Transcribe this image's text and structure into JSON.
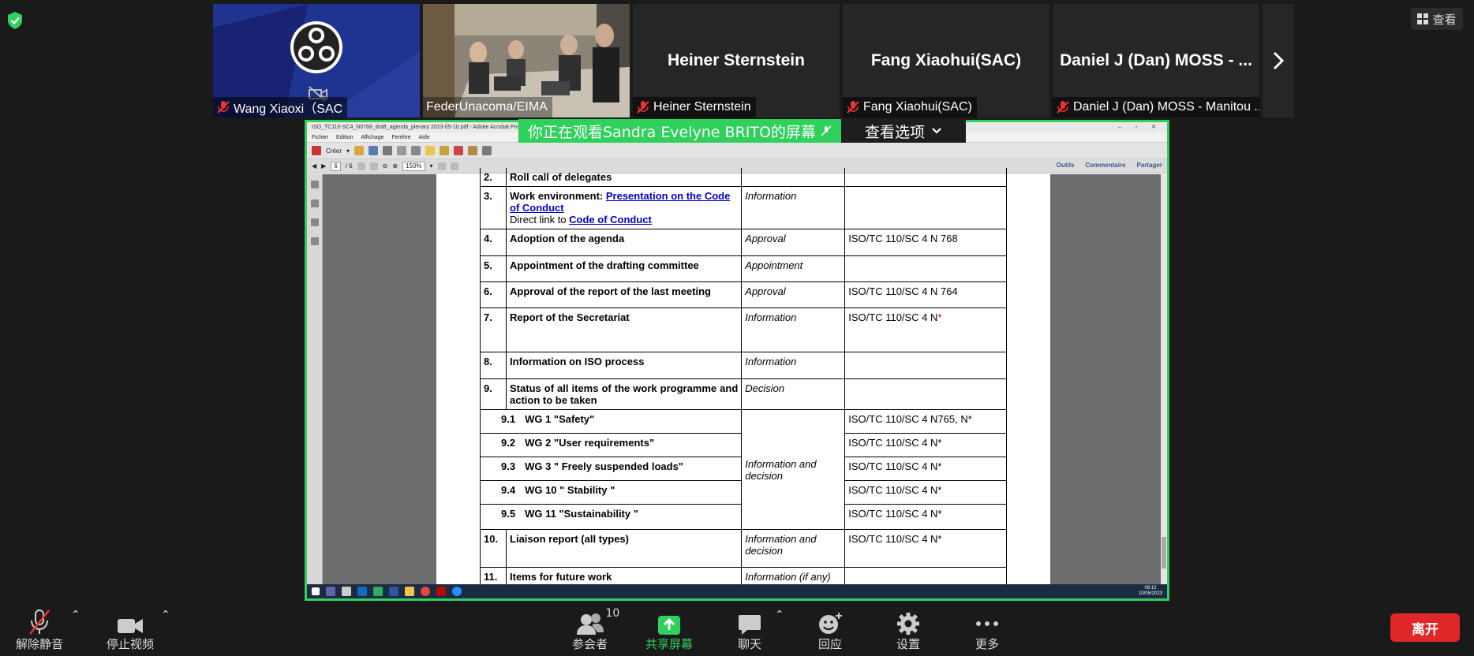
{
  "top": {
    "view_label": "查看"
  },
  "participants": [
    {
      "name": "Wang Xiaoxi（SAC",
      "big_name": "",
      "muted": true,
      "video": "logo"
    },
    {
      "name": "FederUnacoma/EIMA",
      "big_name": "",
      "muted": false,
      "video": "room",
      "active": true
    },
    {
      "name": "Heiner Sternstein",
      "big_name": "Heiner Sternstein",
      "muted": true
    },
    {
      "name": "Fang Xiaohui(SAC)",
      "big_name": "Fang Xiaohui(SAC)",
      "muted": true
    },
    {
      "name": "Daniel J (Dan) MOSS - Manitou ...",
      "big_name": "Daniel J (Dan) MOSS - ...",
      "muted": true
    }
  ],
  "share_banner": {
    "viewing": "你正在观看Sandra Evelyne BRITO的屏幕",
    "options": "查看选项"
  },
  "acrobat": {
    "title": "ISO_TC110-SC4_N0768_draft_agenda_plenary 2023-05-10.pdf - Adobe Acrobat Pro",
    "menus": [
      "Fichier",
      "Edition",
      "Affichage",
      "Fenêtre",
      "Aide"
    ],
    "create": "Créer",
    "page_current": "6",
    "page_total": "/ 6",
    "zoom": "150%",
    "right_links": [
      "Outils",
      "Commentaire",
      "Partager"
    ]
  },
  "agenda": {
    "row2": {
      "num": "2.",
      "item": "Roll call of delegates"
    },
    "row3": {
      "num": "3.",
      "item_prefix": "Work environment: ",
      "link1": "Presentation on the Code of Conduct",
      "direct": "Direct link to ",
      "link2": "Code of Conduct",
      "type": "Information"
    },
    "row4": {
      "num": "4.",
      "item": "Adoption of the agenda",
      "type": "Approval",
      "doc": "ISO/TC 110/SC 4 N 768"
    },
    "row5": {
      "num": "5.",
      "item": "Appointment of the drafting committee",
      "type": "Appointment"
    },
    "row6": {
      "num": "6.",
      "item": "Approval of the report of the last meeting",
      "type": "Approval",
      "doc": "ISO/TC 110/SC 4 N 764"
    },
    "row7": {
      "num": "7.",
      "item": "Report of the Secretariat",
      "type": "Information",
      "doc": "ISO/TC 110/SC 4 N",
      "star": "*"
    },
    "row8": {
      "num": "8.",
      "item": "Information on ISO process",
      "type": "Information"
    },
    "row9": {
      "num": "9.",
      "item": "Status of all items of the work programme and action to be taken",
      "type": "Decision"
    },
    "sub_type": "Information and decision",
    "subs": [
      {
        "num": "9.1",
        "label": "WG 1 \"Safety\"",
        "doc": "ISO/TC 110/SC 4 N765, N*"
      },
      {
        "num": "9.2",
        "label": "WG 2 \"User requirements\"",
        "doc": "ISO/TC 110/SC 4 N*"
      },
      {
        "num": "9.3",
        "label": "WG 3 \" Freely suspended loads\"",
        "doc": "ISO/TC 110/SC 4 N*"
      },
      {
        "num": "9.4",
        "label": "WG 10 \" Stability \"",
        "doc": "ISO/TC 110/SC 4 N*"
      },
      {
        "num": "9.5",
        "label": "WG 11 \"Sustainability \"",
        "doc": "ISO/TC 110/SC 4 N*"
      }
    ],
    "row10": {
      "num": "10.",
      "item": "Liaison report (all types)",
      "type": "Information and decision",
      "doc": "ISO/TC 110/SC 4 N*"
    },
    "row11": {
      "num": "11.",
      "item": "Items for future work",
      "type": "Information (if any)"
    }
  },
  "taskbar_clock": {
    "time": "09:12",
    "date": "10/05/2023"
  },
  "toolbar": {
    "unmute": "解除静音",
    "stop_video": "停止视频",
    "participants": "参会者",
    "participants_count": "10",
    "share": "共享屏幕",
    "chat": "聊天",
    "react": "回应",
    "settings": "设置",
    "more": "更多",
    "leave": "离开"
  },
  "colors": {
    "accent_green": "#2fd05c",
    "leave_red": "#e02828",
    "background": "#1a1a1a"
  }
}
